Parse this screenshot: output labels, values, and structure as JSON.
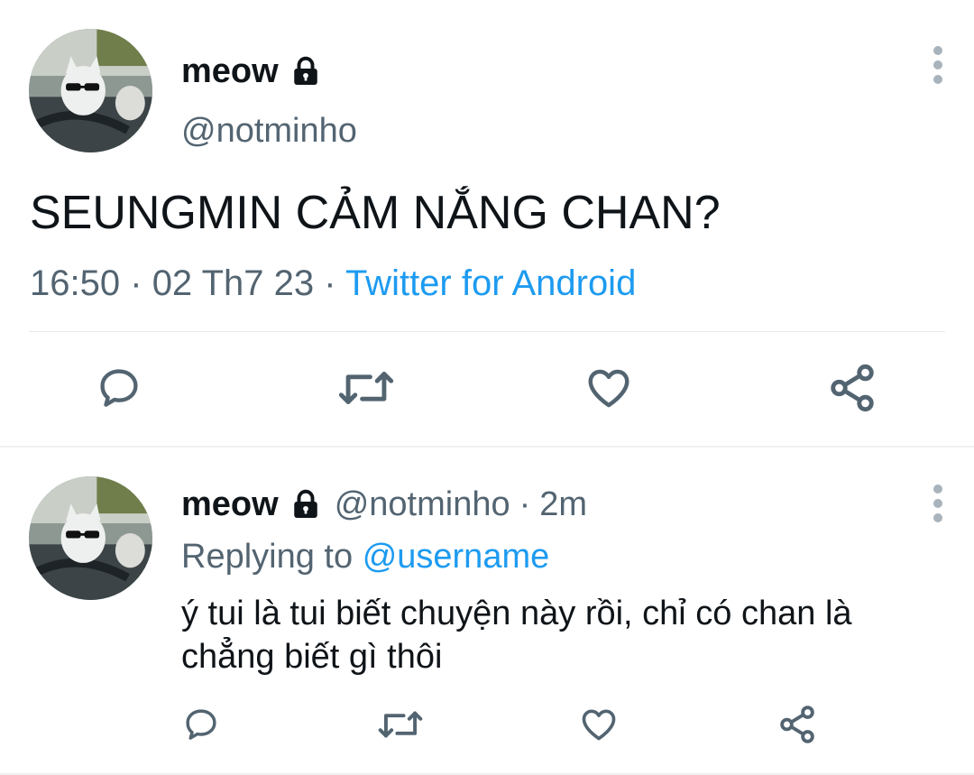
{
  "main_tweet": {
    "display_name": "meow",
    "handle": "@notminho",
    "text": "SEUNGMIN CẢM NẮNG CHAN?",
    "time": "16:50",
    "separator": "·",
    "date": "02 Th7 23",
    "source": "Twitter for Android",
    "actions": [
      "reply-icon",
      "retweet-icon",
      "like-icon",
      "share-icon"
    ]
  },
  "reply_tweet": {
    "display_name": "meow",
    "handle": "@notminho",
    "separator": "·",
    "age": "2m",
    "replying_prefix": "Replying to",
    "replying_to": "@username",
    "text": "ý tui là tui biết chuyện này rồi, chỉ có chan là chẳng biết gì thôi",
    "actions": [
      "reply-icon",
      "retweet-icon",
      "like-icon",
      "share-icon"
    ]
  },
  "colors": {
    "text_primary": "#0f1419",
    "text_secondary": "#536471",
    "link": "#1d9bf0",
    "icon": "#536471",
    "divider": "#eff1f3"
  }
}
